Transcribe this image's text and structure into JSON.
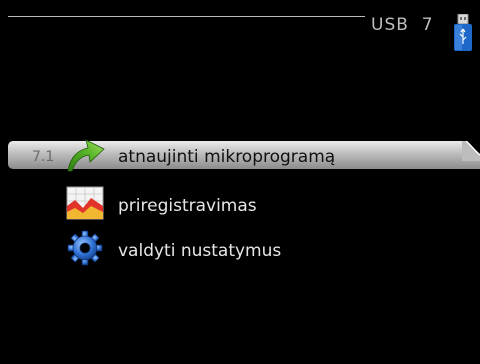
{
  "header": {
    "title": "USB  7",
    "icon": "usb-stick-icon"
  },
  "menu": {
    "items": [
      {
        "number": "7.1",
        "label": "atnaujinti mikroprogramą",
        "icon": "firmware-update-arrow-icon",
        "selected": true
      },
      {
        "number": "",
        "label": "priregistravimas",
        "icon": "logging-chart-icon",
        "selected": false
      },
      {
        "number": "",
        "label": "valdyti nustatymus",
        "icon": "settings-gear-icon",
        "selected": false
      }
    ]
  },
  "colors": {
    "background": "#000000",
    "header_text": "#bdbdbd",
    "selection_bar": "#bdbdbd",
    "accent_green": "#5bb82a",
    "accent_blue": "#1f6fd0"
  }
}
